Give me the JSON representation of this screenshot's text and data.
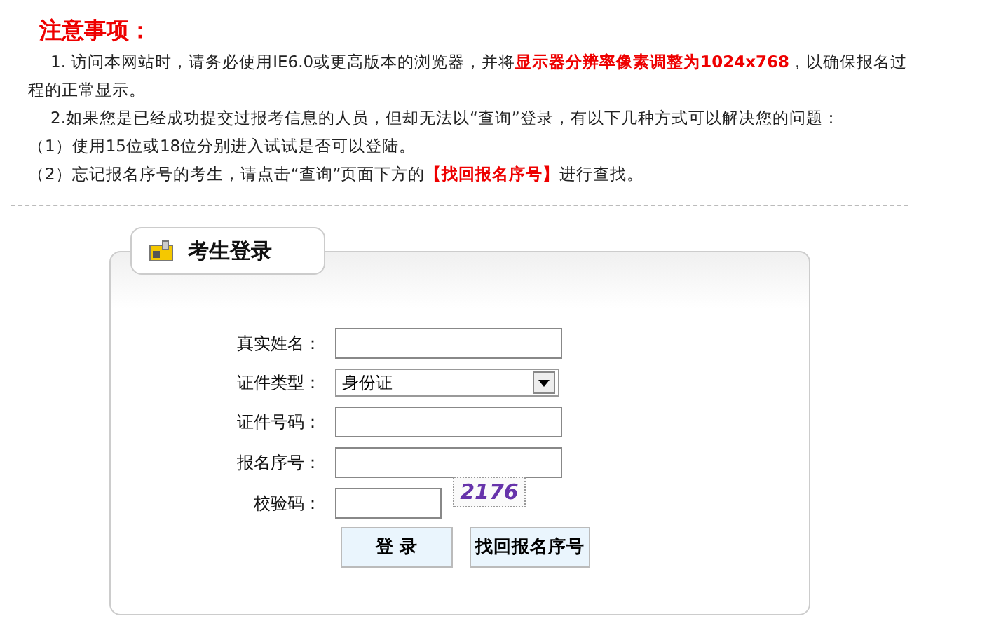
{
  "notice": {
    "title": "注意事项：",
    "items": [
      "1. 访问本网站时，请务必使用IE6.0或更高版本的浏览器，并将**显示器分辨率像素调整为1024x768**，以确保报名过程的正常显示。",
      "2.如果您是已经成功提交过报考信息的人员，但却无法以“查询”登录，有以下几种方式可以解决您的问题：",
      "（1）使用15位或18位分别进入试试是否可以登陆。",
      "（2）忘记报名序号的考生，请点击“查询”页面下方的**【找回报名序号】**进行查找。"
    ]
  },
  "login": {
    "title": "考生登录",
    "fields": [
      {
        "kind": "text",
        "label": "真实姓名："
      },
      {
        "kind": "select",
        "label": "证件类型：",
        "value": "身份证"
      },
      {
        "kind": "text",
        "label": "证件号码："
      },
      {
        "kind": "text",
        "label": "报名序号："
      },
      {
        "kind": "captcha",
        "label": "校验码：",
        "captcha": "2176"
      }
    ],
    "buttons": [
      "登 录",
      "找回报名序号"
    ]
  }
}
